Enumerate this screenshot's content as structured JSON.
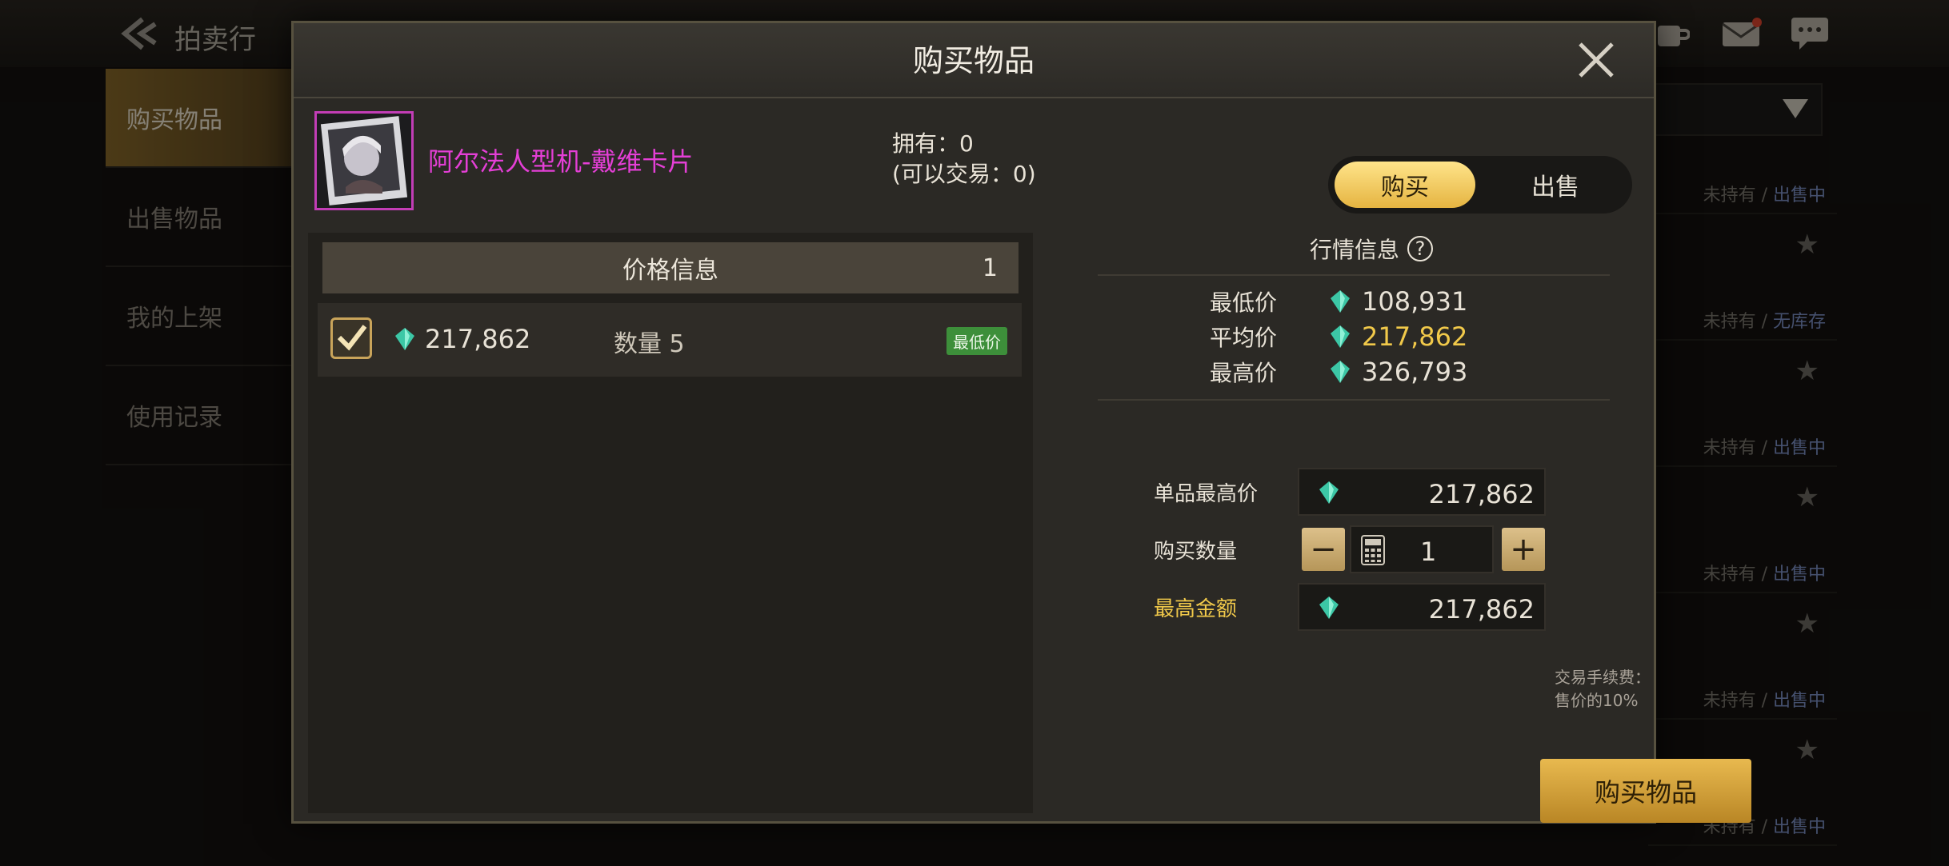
{
  "background": {
    "title": "拍卖行",
    "sidebar": [
      "购买物品",
      "出售物品",
      "我的上架",
      "使用记录"
    ],
    "rows": [
      {
        "owned": "未持有",
        "stock": "出售中"
      },
      {
        "owned": "未持有",
        "stock": "无库存"
      },
      {
        "owned": "未持有",
        "stock": "出售中"
      },
      {
        "owned": "未持有",
        "stock": "出售中"
      },
      {
        "owned": "未持有",
        "stock": "出售中"
      },
      {
        "owned": "未持有",
        "stock": "出售中"
      }
    ]
  },
  "modal": {
    "title": "购买物品",
    "item_name": "阿尔法人型机-戴维卡片",
    "own_label": "拥有：0",
    "tradable_label": "(可以交易：0)",
    "toggle_buy": "购买",
    "toggle_sell": "出售",
    "price_info": {
      "header": "价格信息",
      "count": "1",
      "listing": {
        "price": "217,862",
        "qty_label": "数量 5",
        "badge": "最低价"
      }
    },
    "market": {
      "title": "行情信息",
      "lowest_label": "最低价",
      "lowest": "108,931",
      "avg_label": "平均价",
      "avg": "217,862",
      "highest_label": "最高价",
      "highest": "326,793"
    },
    "form": {
      "unit_max_label": "单品最高价",
      "unit_max": "217,862",
      "qty_label": "购买数量",
      "qty": "1",
      "total_label": "最高金额",
      "total": "217,862",
      "fee": "交易手续费：售价的10%"
    },
    "buy_button": "购买物品"
  },
  "colors": {
    "accent": "#e5b441",
    "item_rarity": "#e43fd6",
    "avg_price": "#f1c94a",
    "total_label": "#f1c94a",
    "status_highlight": "#7e92c8"
  }
}
